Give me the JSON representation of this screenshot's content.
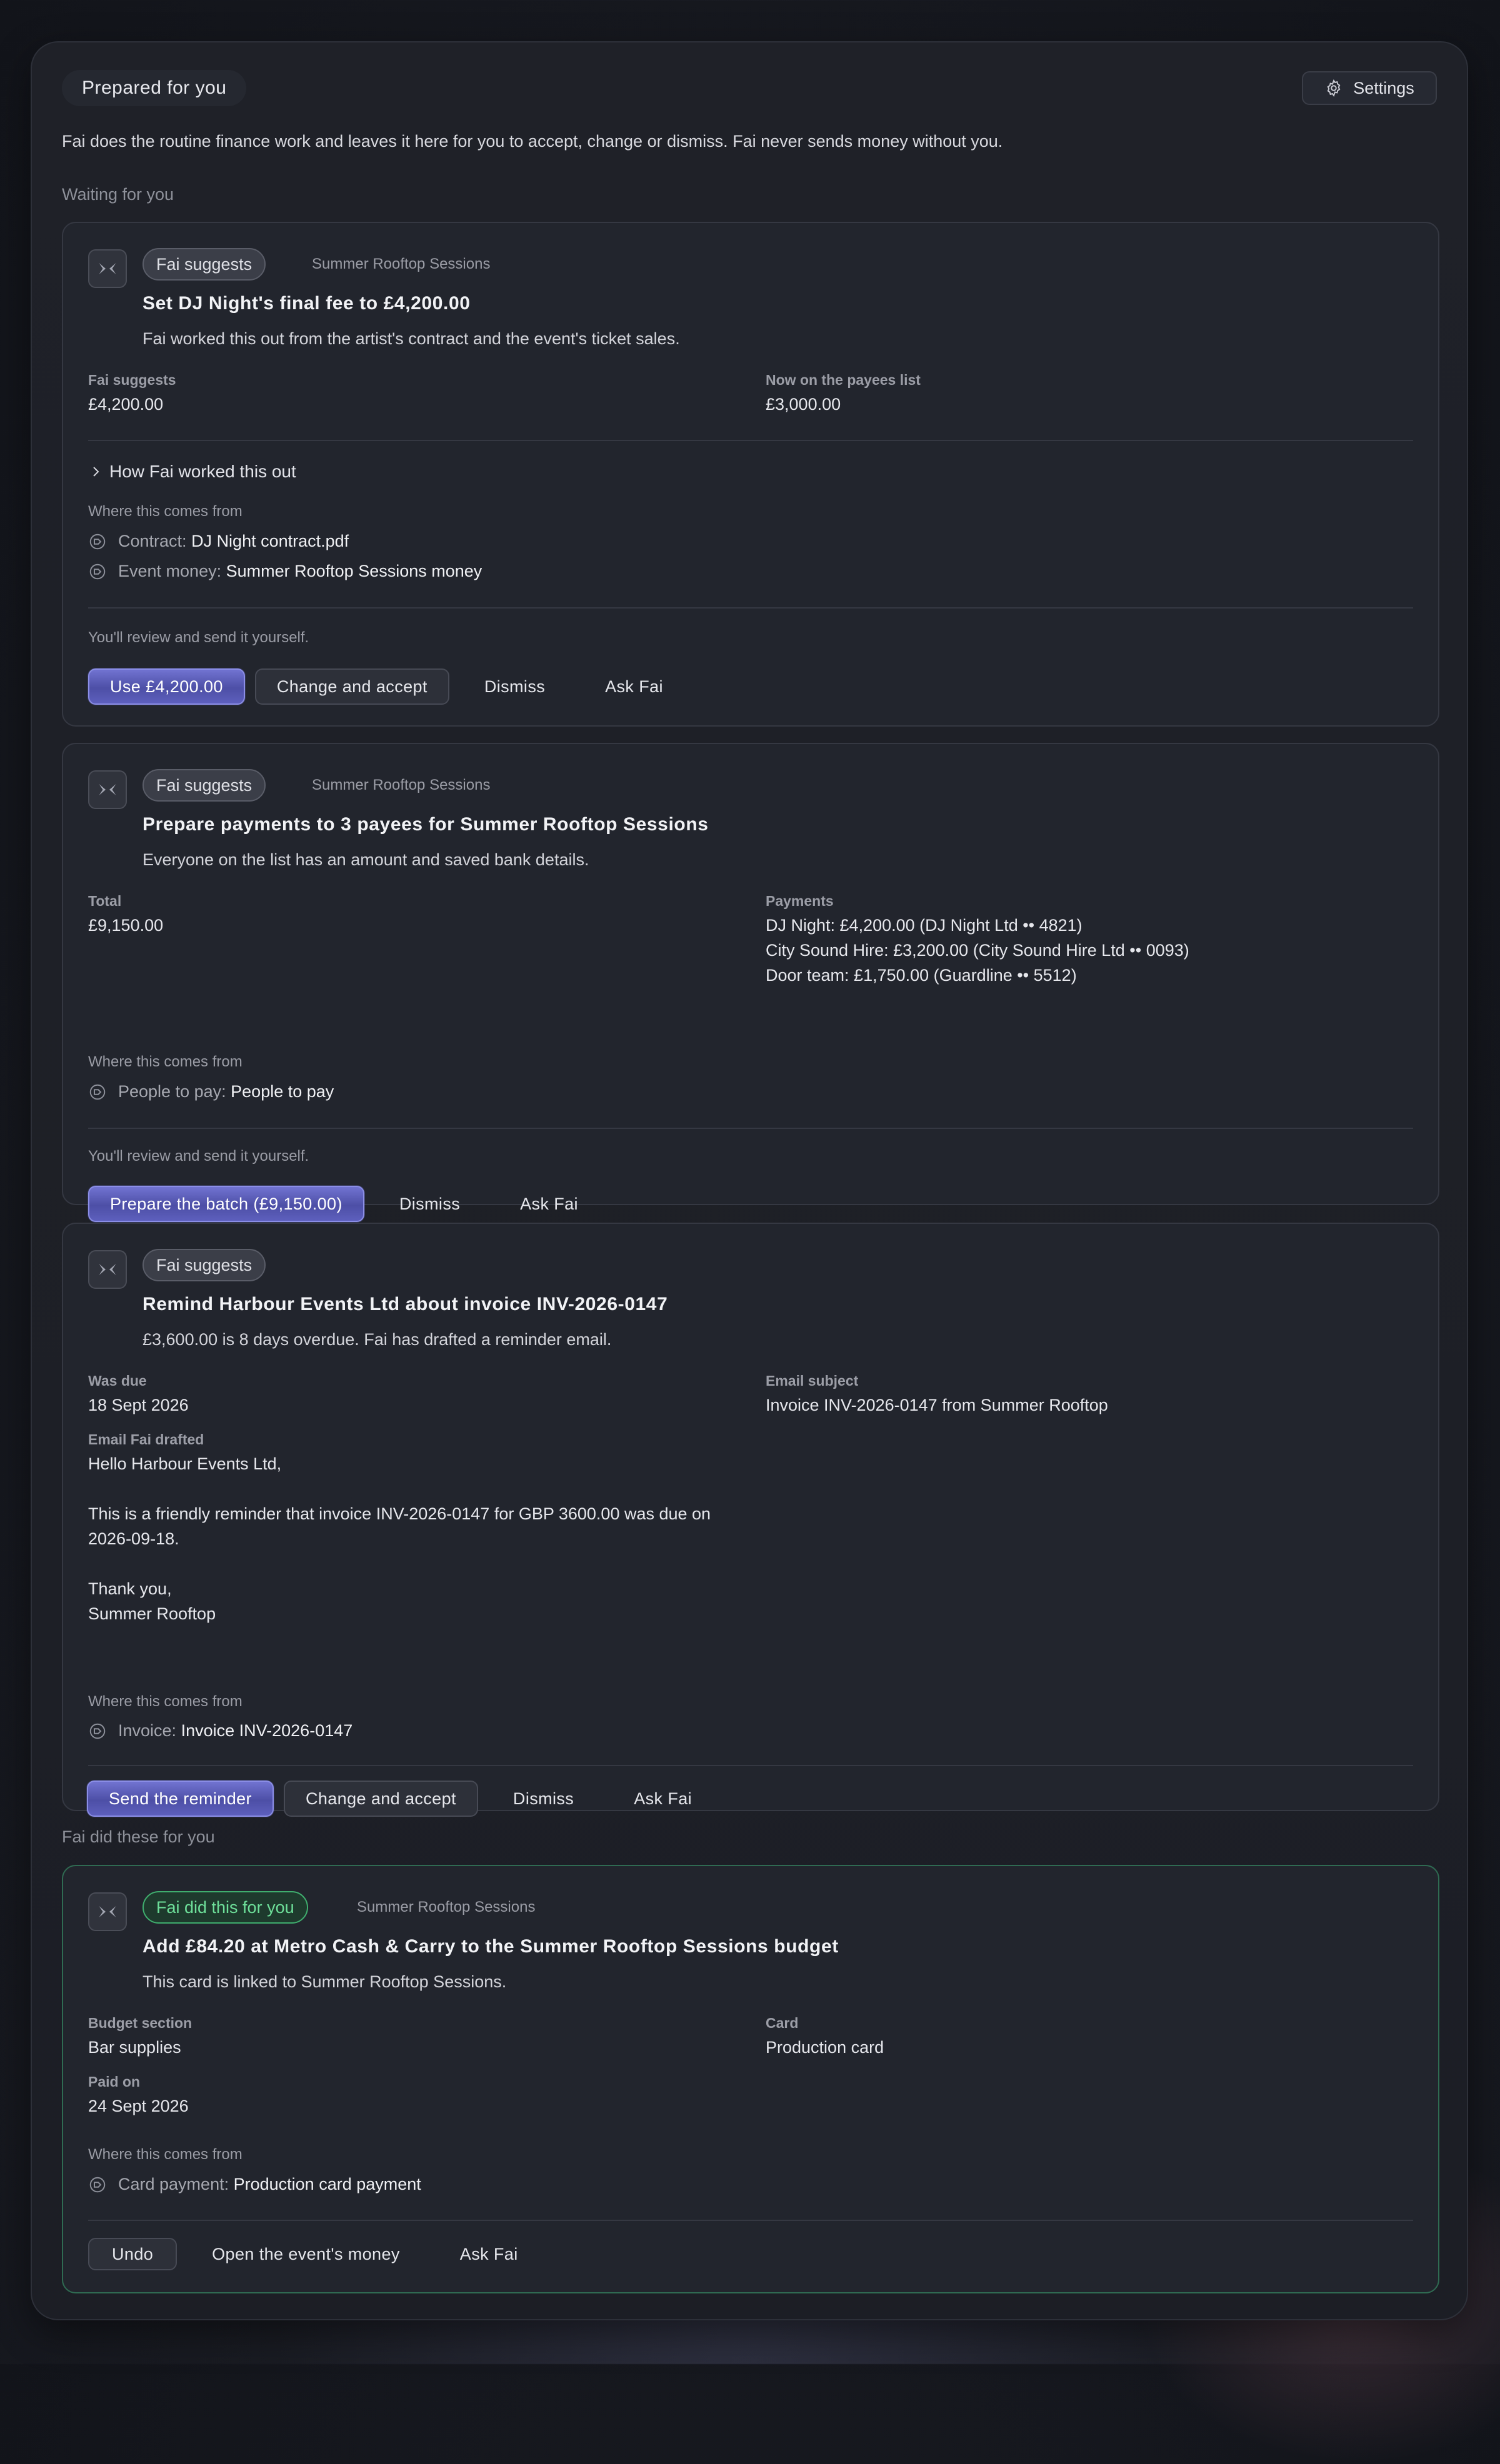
{
  "header": {
    "title": "Prepared for you",
    "settings_label": "Settings"
  },
  "intro": "Fai does the routine finance work and leaves it here for you to accept, change or dismiss. Fai never sends money without you.",
  "sections": {
    "waiting": "Waiting for you",
    "done": "Fai did these for you"
  },
  "common": {
    "badge_suggests": "Fai suggests",
    "badge_done": "Fai did this for you",
    "where_from": "Where this comes from",
    "review_note": "You'll review and send it yourself.",
    "dismiss": "Dismiss",
    "ask_fai": "Ask Fai",
    "change_accept": "Change and accept"
  },
  "cards": [
    {
      "event": "Summer Rooftop Sessions",
      "title": "Set DJ Night's final fee to £4,200.00",
      "subtitle": "Fai worked this out from the artist's contract and the event's ticket sales.",
      "fields": [
        {
          "label": "Fai suggests",
          "value": "£4,200.00"
        },
        {
          "label": "Now on the payees list",
          "value": "£3,000.00"
        }
      ],
      "expander": "How Fai worked this out",
      "sources": [
        {
          "label": "Contract:",
          "value": "DJ Night contract.pdf"
        },
        {
          "label": "Event money:",
          "value": "Summer Rooftop Sessions money"
        }
      ],
      "primary": "Use £4,200.00"
    },
    {
      "event": "Summer Rooftop Sessions",
      "title": "Prepare payments to 3 payees for Summer Rooftop Sessions",
      "subtitle": "Everyone on the list has an amount and saved bank details.",
      "fields": [
        {
          "label": "Total",
          "value": "£9,150.00"
        },
        {
          "label": "Payments",
          "lines": [
            "DJ Night: £4,200.00 (DJ Night Ltd •• 4821)",
            "City Sound Hire: £3,200.00 (City Sound Hire Ltd •• 0093)",
            "Door team: £1,750.00 (Guardline •• 5512)"
          ]
        }
      ],
      "sources": [
        {
          "label": "People to pay:",
          "value": "People to pay"
        }
      ],
      "primary": "Prepare the batch (£9,150.00)"
    },
    {
      "title": "Remind Harbour Events Ltd about invoice INV-2026-0147",
      "subtitle": "£3,600.00 is 8 days overdue. Fai has drafted a reminder email.",
      "fields": [
        {
          "label": "Was due",
          "value": "18 Sept 2026"
        },
        {
          "label": "Email subject",
          "value": "Invoice INV-2026-0147 from Summer Rooftop"
        },
        {
          "label": "Email Fai drafted",
          "value": "Hello Harbour Events Ltd,\n\nThis is a friendly reminder that invoice INV-2026-0147 for GBP 3600.00 was due on 2026-09-18.\n\nThank you,\nSummer Rooftop"
        }
      ],
      "sources": [
        {
          "label": "Invoice:",
          "value": "Invoice INV-2026-0147"
        }
      ],
      "primary": "Send the reminder"
    },
    {
      "event": "Summer Rooftop Sessions",
      "title": "Add £84.20 at Metro Cash & Carry to the Summer Rooftop Sessions budget",
      "subtitle": "This card is linked to Summer Rooftop Sessions.",
      "fields": [
        {
          "label": "Budget section",
          "value": "Bar supplies"
        },
        {
          "label": "Card",
          "value": "Production card"
        },
        {
          "label": "Paid on",
          "value": "24 Sept 2026"
        }
      ],
      "sources": [
        {
          "label": "Card payment:",
          "value": "Production card payment"
        }
      ],
      "undo": "Undo",
      "open_money": "Open the event's money"
    }
  ]
}
